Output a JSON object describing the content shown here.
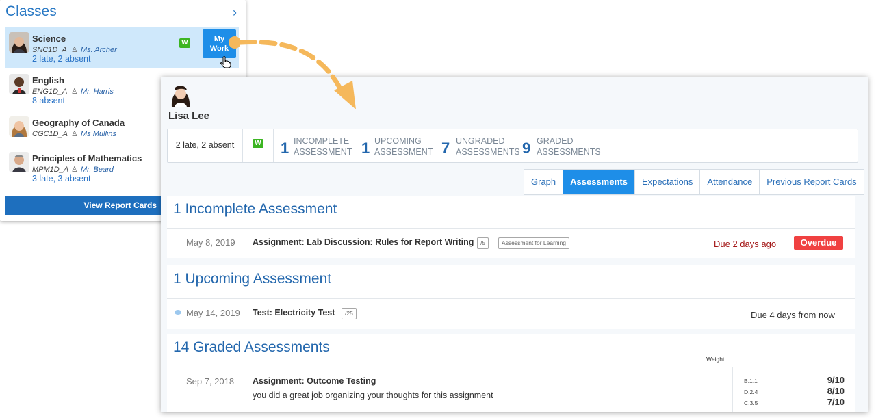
{
  "classes_panel": {
    "title": "Classes",
    "chevron": "›",
    "mywork_line1": "My",
    "mywork_line2": "Work",
    "view_report_label": "View Report Cards",
    "items": [
      {
        "name": "Science",
        "code": "SNC1D_A",
        "teacher": "Ms. Archer",
        "attendance": "2 late, 2 absent",
        "badge": "W",
        "selected": true
      },
      {
        "name": "English",
        "code": "ENG1D_A",
        "teacher": "Mr. Harris",
        "attendance": "8 absent"
      },
      {
        "name": "Geography of Canada",
        "code": "CGC1D_A",
        "teacher": "Ms Mullins",
        "attendance": ""
      },
      {
        "name": "Principles of Mathematics",
        "code": "MPM1D_A",
        "teacher": "Mr. Beard",
        "attendance": "3 late, 3 absent"
      }
    ]
  },
  "student": {
    "name": "Lisa Lee",
    "attendance": "2 late, 2 absent",
    "badge": "W",
    "stats": [
      {
        "num": "1",
        "line1": "INCOMPLETE",
        "line2": "ASSESSMENT"
      },
      {
        "num": "1",
        "line1": "UPCOMING",
        "line2": "ASSESSMENT"
      },
      {
        "num": "7",
        "line1": "UNGRADED",
        "line2": "ASSESSMENTS"
      },
      {
        "num": "9",
        "line1": "GRADED",
        "line2": "ASSESSMENTS"
      }
    ]
  },
  "tabs": [
    {
      "label": "Graph",
      "active": false
    },
    {
      "label": "Assessments",
      "active": true
    },
    {
      "label": "Expectations",
      "active": false
    },
    {
      "label": "Attendance",
      "active": false
    },
    {
      "label": "Previous Report Cards",
      "active": false
    }
  ],
  "incomplete": {
    "title": "1 Incomplete Assessment",
    "date": "May 8, 2019",
    "item_title": "Assignment: Lab Discussion: Rules for Report Writing",
    "out_of": "/5",
    "category": "Assessment for Learning",
    "due": "Due 2 days ago",
    "status": "Overdue"
  },
  "upcoming": {
    "title": "1 Upcoming Assessment",
    "date": "May 14, 2019",
    "item_title": "Test: Electricity Test",
    "out_of": "/25",
    "due": "Due 4 days from now"
  },
  "graded": {
    "title": "14 Graded Assessments",
    "weight_label": "Weight",
    "date": "Sep 7, 2018",
    "item_title": "Assignment: Outcome Testing",
    "comment": "you did a great job organizing your thoughts for this assignment",
    "expectations": [
      {
        "code": "B.1.1",
        "score": "9/10"
      },
      {
        "code": "D.2.4",
        "score": "8/10"
      },
      {
        "code": "C.3.5",
        "score": "7/10"
      }
    ]
  },
  "colors": {
    "accent": "#1e8ee8",
    "link": "#2367ad",
    "overdue": "#f04141",
    "badge": "#3cb522",
    "selected_row": "#cfe8fb",
    "arrow": "#f5b85b"
  }
}
